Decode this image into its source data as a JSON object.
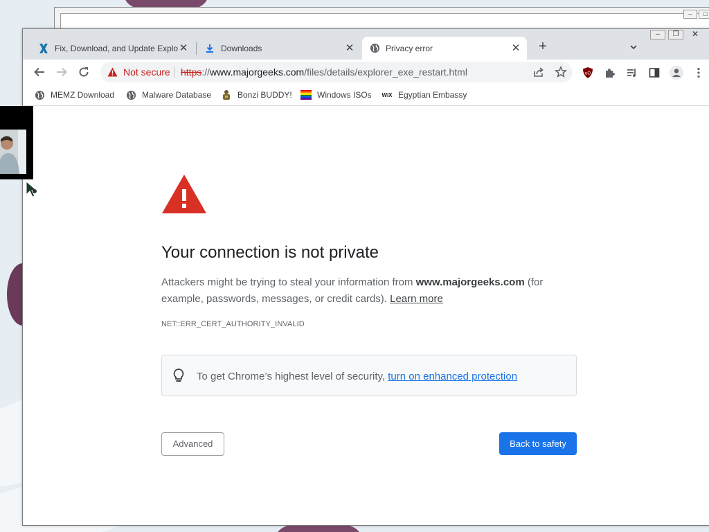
{
  "browser": {
    "tabs": [
      {
        "title": "Fix, Download, and Update Explo",
        "icon": "x-logo-icon",
        "active": false
      },
      {
        "title": "Downloads",
        "icon": "download-icon",
        "active": false
      },
      {
        "title": "Privacy error",
        "icon": "globe-icon",
        "active": true
      }
    ],
    "new_tab_label": "+",
    "security_label": "Not secure",
    "url": {
      "scheme": "https",
      "separator": "://",
      "host": "www.majorgeeks.com",
      "path": "/files/details/explorer_exe_restart.html"
    }
  },
  "bookmarks": [
    {
      "label": "MEMZ Download",
      "icon": "globe-icon"
    },
    {
      "label": "Malware Database",
      "icon": "globe-icon"
    },
    {
      "label": "Bonzi BUDDY!",
      "icon": "bonzi-icon"
    },
    {
      "label": "Windows ISOs",
      "icon": "rainbow-flag-icon"
    },
    {
      "label": "Egyptian Embassy",
      "icon": "wix-icon"
    }
  ],
  "error": {
    "heading": "Your connection is not private",
    "desc_prefix": "Attackers might be trying to steal your information from ",
    "desc_host": "www.majorgeeks.com",
    "desc_suffix": " (for example, passwords, messages, or credit cards). ",
    "learn_more": "Learn more",
    "code": "NET::ERR_CERT_AUTHORITY_INVALID",
    "tip_prefix": "To get Chrome’s highest level of security, ",
    "tip_link": "turn on enhanced protection",
    "advanced_label": "Advanced",
    "back_label": "Back to safety"
  },
  "colors": {
    "accent": "#1a73e8",
    "danger": "#d93025",
    "insecure_text": "#c5221f"
  }
}
